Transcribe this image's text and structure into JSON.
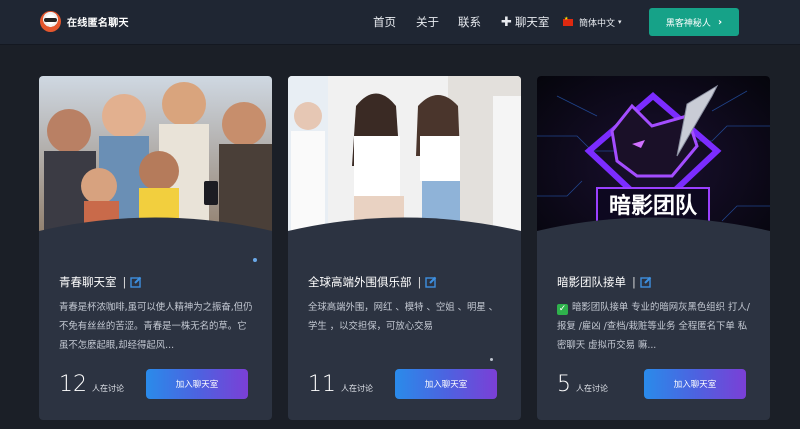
{
  "nav": {
    "brand": "在线匿名聊天",
    "menu": [
      "首页",
      "关于",
      "联系",
      "聊天室"
    ],
    "language": "簡体中文",
    "cta": "黑客神秘人"
  },
  "cards": [
    {
      "title": "青春聊天室",
      "separator": "|",
      "description": "青春是杯浓咖啡,虽可以使人精神为之振奋,但仍不免有丝丝的苦涩。青春是一株无名的草。它虽不怎麼起眼,却经得起风...",
      "count": "12",
      "count_label": "人在讨论",
      "button": "加入聊天室"
    },
    {
      "title": "全球高端外围俱乐部",
      "separator": "|",
      "description": "全球高端外围，网红 、模特 、空姐 、明星 、学生 ，以交担保，可放心交易",
      "count": "11",
      "count_label": "人在讨论",
      "button": "加入聊天室"
    },
    {
      "title": "暗影团队接单",
      "separator": "|",
      "description": "暗影团队接单 专业的暗网灰黑色组织 打人/报复 /雇凶 /查档/栽赃等业务 全程匿名下单 私密聊天 虚拟币交易 嘛...",
      "count": "5",
      "count_label": "人在讨论",
      "button": "加入聊天室",
      "image_text": "暗影团队"
    }
  ],
  "colors": {
    "background": "#1b1f27",
    "nav": "#1f2633",
    "card": "#2c3341",
    "cta": "#16a288",
    "button_start": "#2a8bea",
    "button_end": "#7b3fd6",
    "edit_icon": "#3d8fe0"
  }
}
